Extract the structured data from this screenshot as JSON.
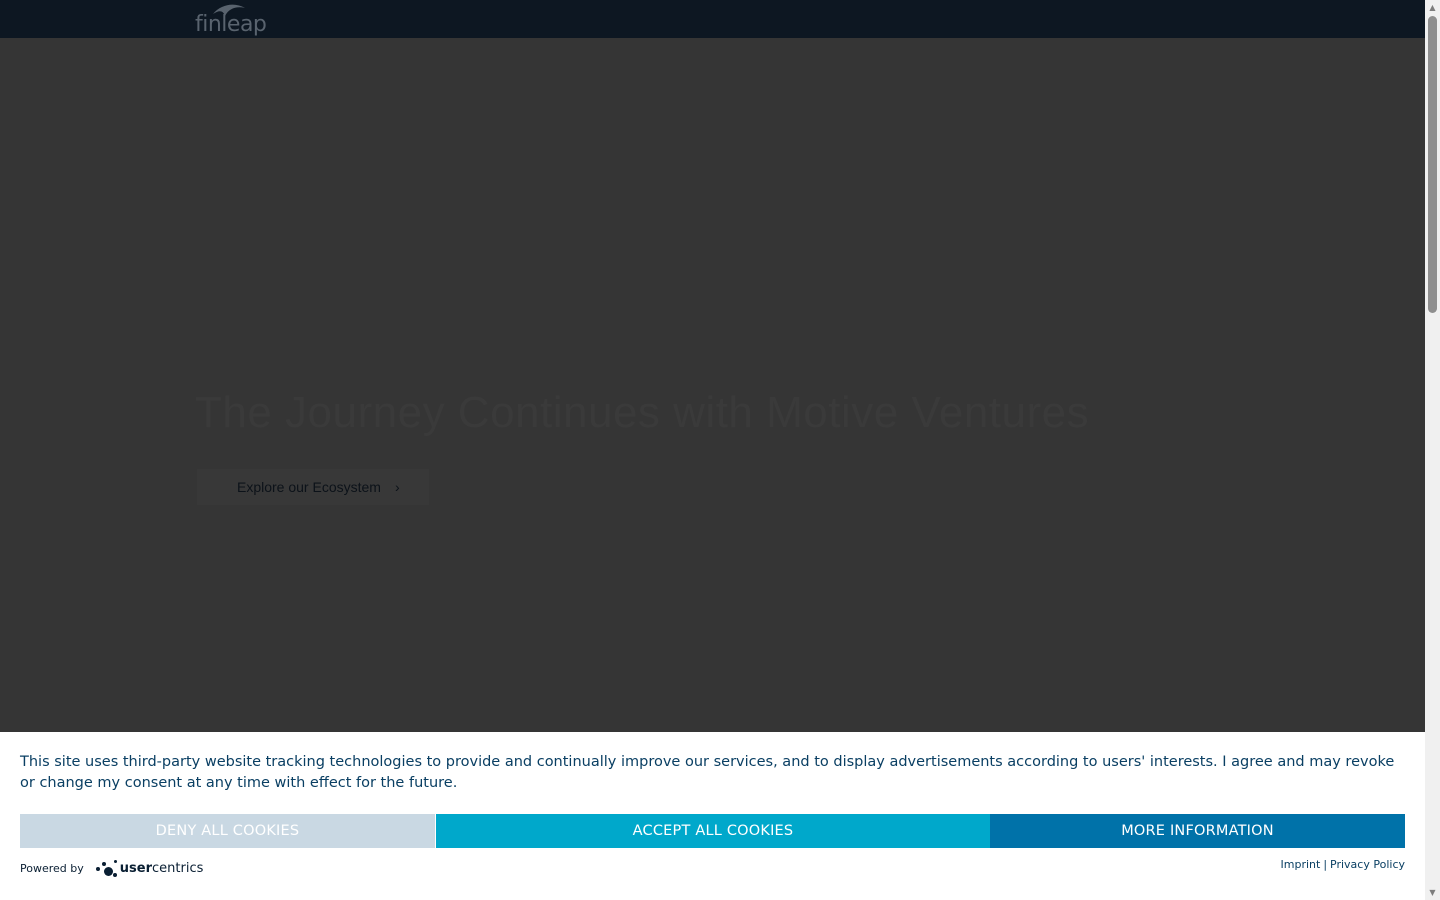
{
  "header": {
    "logo_text": "finleap"
  },
  "hero": {
    "title": "The Journey Continues with Motive Ventures",
    "cta_label": "Explore our Ecosystem",
    "cta_icon": "chevron-right-icon"
  },
  "cookie_banner": {
    "message": "This site uses third-party website tracking technologies to provide and continually improve our services, and to display advertisements according to users' interests. I agree and may revoke or change my consent at any time with effect for the future.",
    "deny_label": "DENY ALL COOKIES",
    "accept_label": "ACCEPT ALL COOKIES",
    "more_label": "MORE INFORMATION",
    "powered_by": "Powered by",
    "brand_prefix": "user",
    "brand_suffix": "centrics",
    "imprint": "Imprint",
    "separator": "|",
    "privacy_policy": "Privacy Policy",
    "colors": {
      "deny": "#c9d8e3",
      "accept": "#00a8cb",
      "more": "#0072a9",
      "text": "#0a3f63"
    }
  }
}
